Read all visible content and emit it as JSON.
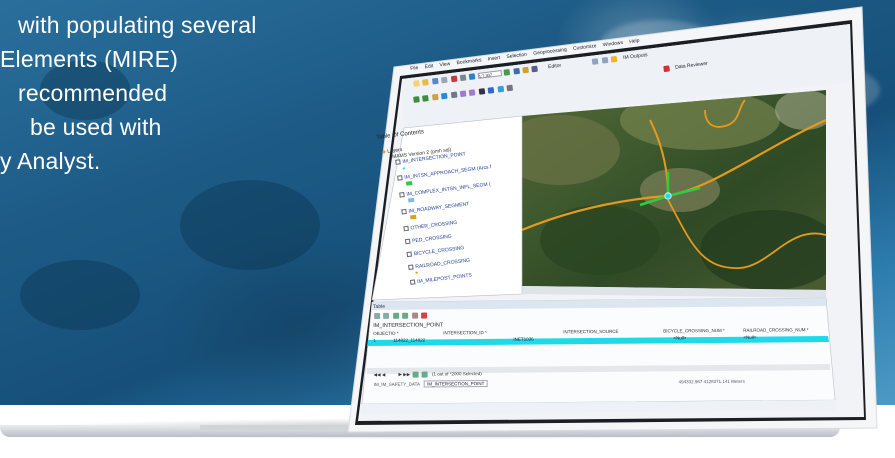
{
  "hero": {
    "lines": [
      "with populating several",
      "Elements (MIRE)",
      "recommended",
      "be used with",
      "y Analyst."
    ]
  },
  "app": {
    "menu": [
      "File",
      "Edit",
      "View",
      "Bookmarks",
      "Insert",
      "Selection",
      "Geoprocessing",
      "Customize",
      "Windows",
      "Help"
    ],
    "scale_value": "1:7,307",
    "editor_label": "Editor",
    "toolbar_right_label": "IM Outputs",
    "data_reviewer_label": "Data Reviewer"
  },
  "toc": {
    "title": "Table Of Contents",
    "layers_label": "Layers",
    "group_label": "IMAMS Version 2 (pmh sql)",
    "items": [
      "IM_INTERSECTION_POINT",
      "IM_INTSN_APPROACH_SEGM (Arcs f",
      "IM_COMPLEX_INTSN_INFL_SEGM (",
      "IM_ROADWAY_SEGMENT",
      "OTHER_CROSSING",
      "PED_CROSSING",
      "BICYCLE_CROSSING",
      "RAILROAD_CROSSING",
      "IM_MILEPOST_POINTS"
    ]
  },
  "table": {
    "panel_label": "Table",
    "title": "IM_INTERSECTION_POINT",
    "columns": [
      "OBJECTID *",
      "INTERSECTION_ID *",
      "INTERSECTION_SOURCE",
      "BICYCLE_CROSSING_NUM *",
      "RAILROAD_CROSSING_NUM *"
    ],
    "selected_row": [
      "1",
      "114822_114822",
      "INET1036",
      "<Null>",
      "<Null>"
    ],
    "selection_status": "(1 out of *2000 Selected)",
    "tabs": [
      "IM_IM_SAFETY_DATA",
      "IM_INTERSECTION_POINT"
    ]
  },
  "status": {
    "coordinates": "494332.967 4128371.141 Meters"
  },
  "colors": {
    "accent_cyan": "#1ed9e8",
    "road_orange": "#e59a1e",
    "road_green": "#2ecc40"
  }
}
